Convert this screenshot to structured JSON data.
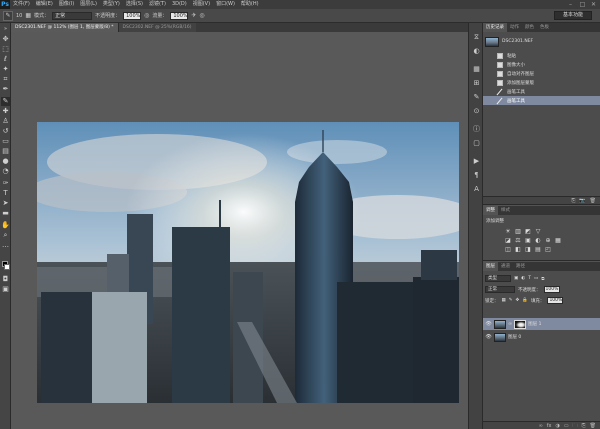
{
  "app": {
    "logo": "Ps"
  },
  "menu": [
    "文件(F)",
    "编辑(E)",
    "图像(I)",
    "图层(L)",
    "类型(Y)",
    "选择(S)",
    "滤镜(T)",
    "3D(D)",
    "视图(V)",
    "窗口(W)",
    "帮助(H)"
  ],
  "window_controls": {
    "minimize": "–",
    "maximize": "□",
    "close": "✕"
  },
  "options": {
    "tool_size": "10",
    "mode_label": "模式：",
    "mode_value": "正常",
    "opacity_label": "不透明度：",
    "opacity_value": "100%",
    "flow_label": "流量：",
    "flow_value": "100%",
    "workspace": "基本功能"
  },
  "documents": {
    "tabs": [
      {
        "label": "DSC2301.NEF @ 112% (图层 1, 图层蒙版/8) *"
      },
      {
        "label": "DSC2302.NEF @ 25%(RGB/16)"
      }
    ]
  },
  "history": {
    "tabs": [
      "历史记录",
      "动作",
      "颜色",
      "色板"
    ],
    "snapshot_name": "DSC2301.NEF",
    "items": [
      {
        "label": "粘贴",
        "selected": false
      },
      {
        "label": "图像大小",
        "selected": false
      },
      {
        "label": "自动对齐图层",
        "selected": false
      },
      {
        "label": "添加图层蒙版",
        "selected": false
      },
      {
        "label": "画笔工具",
        "selected": false
      },
      {
        "label": "画笔工具",
        "selected": true
      }
    ],
    "footer_icons": [
      "⎘",
      "📷",
      "🗑"
    ]
  },
  "adjustments": {
    "tabs": [
      "调整",
      "样式"
    ],
    "title": "添加调整",
    "rows": [
      [
        "☀",
        "▥",
        "◩",
        "▽"
      ],
      [
        "◪",
        "⚖",
        "▣",
        "◐",
        "⊕",
        "▦"
      ],
      [
        "◫",
        "◧",
        "◨",
        "▤",
        "◰"
      ]
    ]
  },
  "layers": {
    "tabs": [
      "图层",
      "通道",
      "路径"
    ],
    "filter_value": "类型",
    "blend_mode": "正常",
    "opacity_label": "不透明度：",
    "opacity_value": "100%",
    "lock_label": "锁定：",
    "fill_label": "填充：",
    "fill_value": "100%",
    "items": [
      {
        "name": "图层 1",
        "selected": true,
        "has_mask": true
      },
      {
        "name": "图层 0",
        "selected": false,
        "has_mask": false
      }
    ],
    "footer_icons": [
      "∞",
      "fx",
      "◑",
      "▭",
      "🗀",
      "⎘",
      "🗑"
    ]
  },
  "colors": {
    "accent_selected": "#7f8aa0",
    "panel_bg": "#4c4c4c",
    "workspace_bg": "#595959"
  }
}
